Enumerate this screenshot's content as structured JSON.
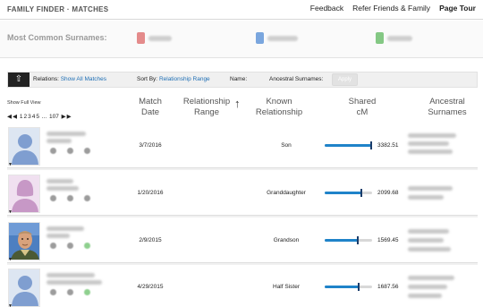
{
  "header": {
    "title": "FAMILY FINDER · MATCHES",
    "links": [
      "Feedback",
      "Refer Friends & Family",
      "Page Tour"
    ]
  },
  "surnames": {
    "label": "Most Common Surnames:",
    "pins": [
      {
        "color": "#e48b8b"
      },
      {
        "color": "#7aa6de"
      },
      {
        "color": "#84c884"
      }
    ]
  },
  "filter_bar": {
    "relations_label": "Relations:",
    "relations_value": "Show All Matches",
    "sort_label": "Sort By:",
    "sort_value": "Relationship Range",
    "name_label": "Name:",
    "surnames_label": "Ancestral Surnames:",
    "apply_label": "Apply"
  },
  "list_controls": {
    "show_full_view": "Show Full View",
    "pager": [
      "◀",
      "◀",
      "1",
      "2",
      "3",
      "4",
      "5",
      "...",
      "107",
      "▶",
      "▶"
    ]
  },
  "columns": {
    "match_date": [
      "Match",
      "Date"
    ],
    "relationship_range": [
      "Relationship",
      "Range"
    ],
    "known_relationship": [
      "Known",
      "Relationship"
    ],
    "shared_cm": [
      "Shared",
      "cM"
    ],
    "ancestral_surnames": [
      "Ancestral",
      "Surnames"
    ]
  },
  "matches": [
    {
      "avatar": "male-silhouette",
      "match_date": "3/7/2016",
      "known_relationship": "Son",
      "shared_cm": "3382.51",
      "cm_fraction": 1.0
    },
    {
      "avatar": "female-silhouette",
      "match_date": "1/20/2016",
      "known_relationship": "Granddaughter",
      "shared_cm": "2099.68",
      "cm_fraction": 0.8
    },
    {
      "avatar": "photo",
      "match_date": "2/9/2015",
      "known_relationship": "Grandson",
      "shared_cm": "1569.45",
      "cm_fraction": 0.71
    },
    {
      "avatar": "male-silhouette",
      "match_date": "4/29/2015",
      "known_relationship": "Half Sister",
      "shared_cm": "1687.56",
      "cm_fraction": 0.73
    }
  ]
}
